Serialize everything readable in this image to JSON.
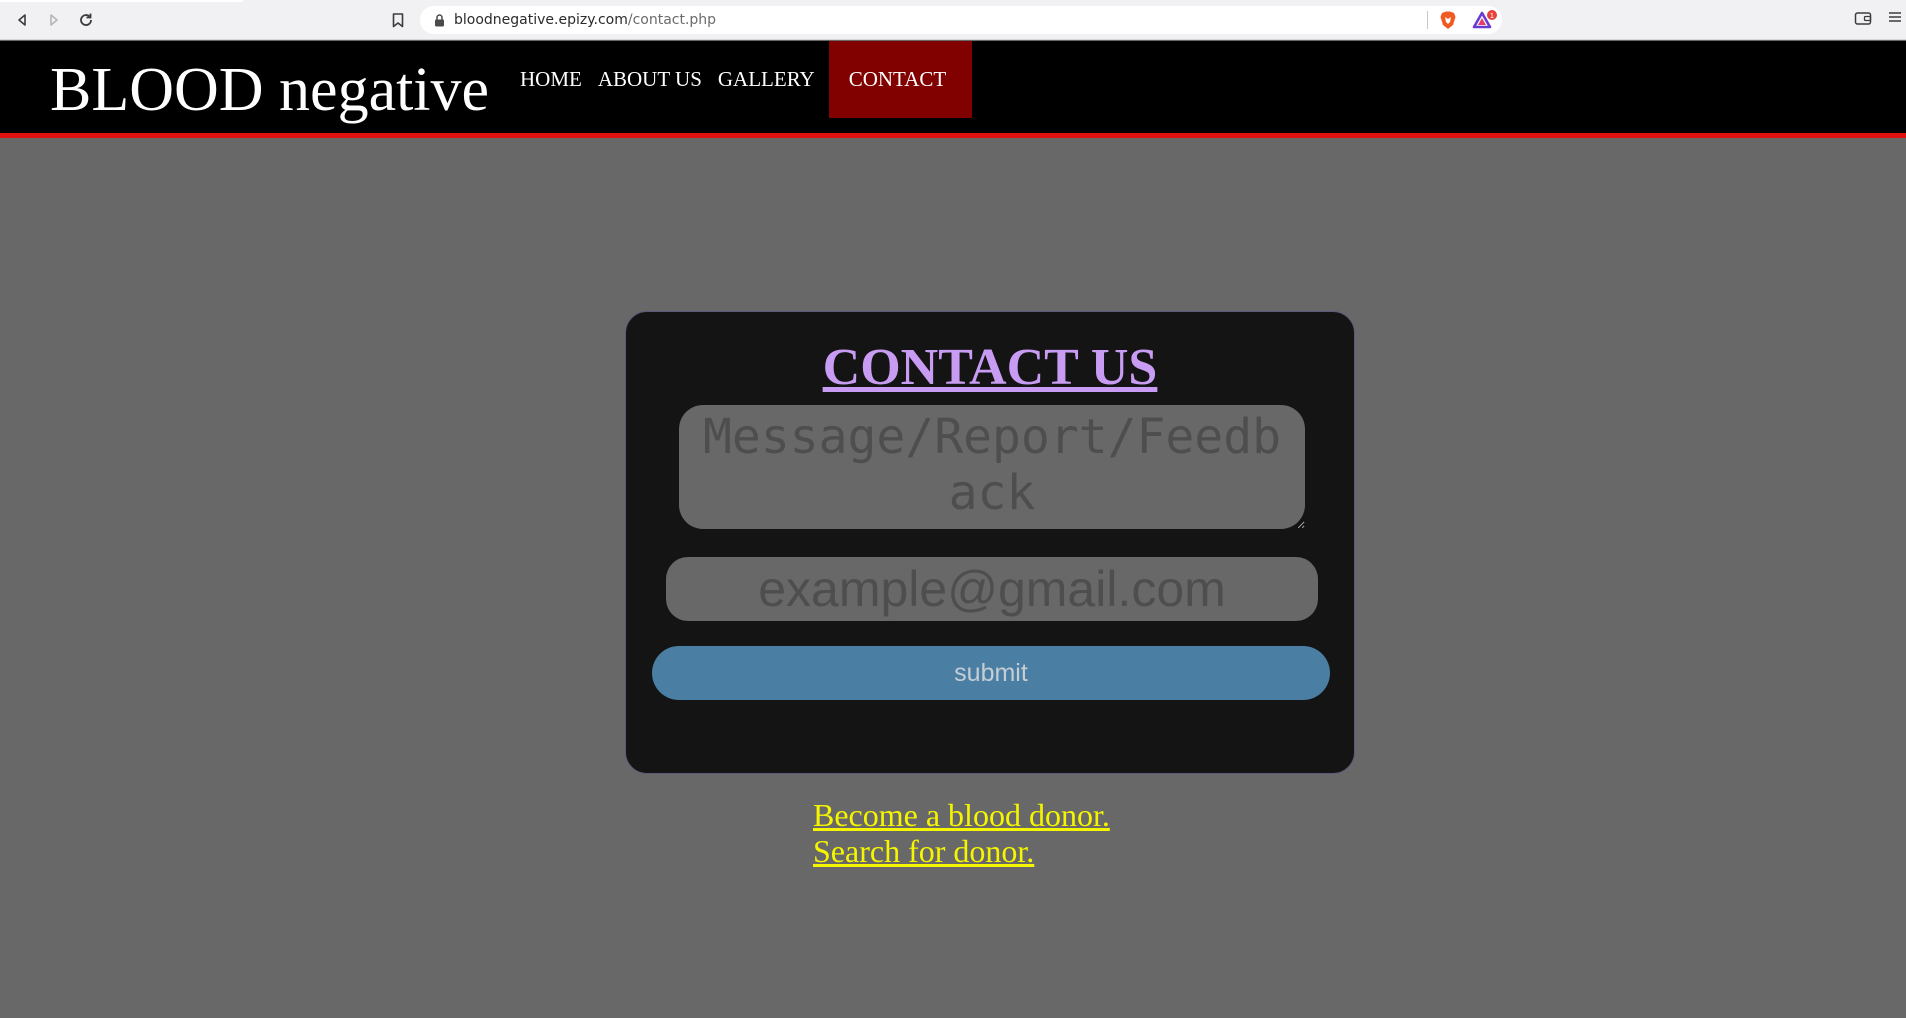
{
  "browser": {
    "url_domain": "bloodnegative.epizy.com",
    "url_path": "/contact.php",
    "rewards_badge": "1"
  },
  "site": {
    "logo": "BLOOD negative",
    "nav": [
      {
        "label": "HOME",
        "active": false
      },
      {
        "label": "ABOUT US",
        "active": false
      },
      {
        "label": "GALLERY",
        "active": false
      },
      {
        "label": "CONTACT",
        "active": true
      }
    ]
  },
  "contact": {
    "title": "CONTACT US",
    "message_placeholder": "Message/Report/Feedback",
    "email_placeholder": "example@gmail.com",
    "submit_label": "submit"
  },
  "links": {
    "become_donor": "Become a blood donor.",
    "search_donor": "Search for donor."
  },
  "colors": {
    "page_bg": "#686868",
    "header_bg": "#000000",
    "header_border": "#e01010",
    "active_nav": "#810000",
    "title": "#c89cf2",
    "submit_bg": "#4a7ea3",
    "link": "#f5f500"
  }
}
